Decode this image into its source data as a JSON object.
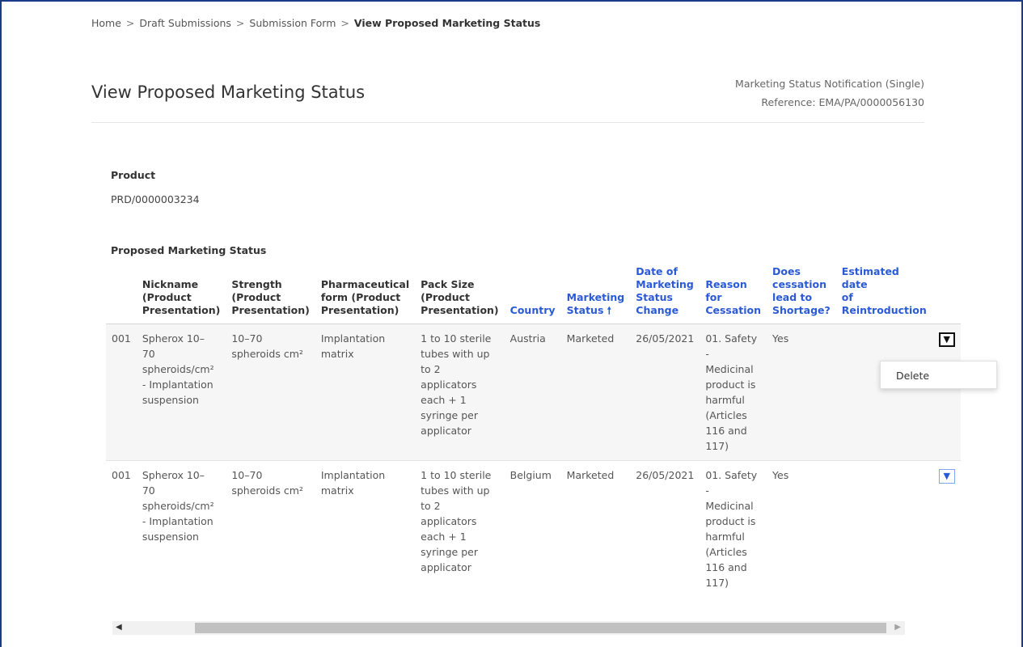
{
  "breadcrumb": {
    "items": [
      "Home",
      "Draft Submissions",
      "Submission Form"
    ],
    "current": "View Proposed Marketing Status",
    "separator": ">"
  },
  "page": {
    "title": "View Proposed Marketing Status",
    "notification_type": "Marketing Status Notification (Single)",
    "reference": "Reference: EMA/PA/0000056130"
  },
  "product": {
    "label": "Product",
    "value": "PRD/0000003234"
  },
  "section_title": "Proposed Marketing Status",
  "table": {
    "headers": {
      "nickname": [
        "Nickname",
        "(Product",
        "Presentation)"
      ],
      "strength": [
        "Strength",
        "(Product",
        "Presentation)"
      ],
      "form": [
        "Pharmaceutical",
        "form (Product",
        "Presentation)"
      ],
      "pack": [
        "Pack Size",
        "(Product",
        "Presentation)"
      ],
      "country": [
        "Country"
      ],
      "status": [
        "Marketing",
        "Status"
      ],
      "date": [
        "Date of",
        "Marketing",
        "Status",
        "Change"
      ],
      "reason": [
        "Reason",
        "for",
        "Cessation"
      ],
      "shortage": [
        "Does",
        "cessation",
        "lead to",
        "Shortage?"
      ],
      "reintro": [
        "Estimated date",
        "of",
        "Reintroduction"
      ]
    },
    "sort_arrow": "🠕",
    "rows": [
      {
        "id": "001",
        "nickname": [
          "Spherox 10–",
          "70",
          "spheroids/cm²",
          "- Implantation",
          "suspension"
        ],
        "strength": [
          "10–70",
          "spheroids cm²"
        ],
        "form": [
          "Implantation",
          "matrix"
        ],
        "pack": [
          "1 to 10 sterile",
          "tubes with up",
          "to 2",
          "applicators",
          "each + 1",
          "syringe per",
          "applicator"
        ],
        "country": "Austria",
        "status": "Marketed",
        "date": "26/05/2021",
        "reason": [
          "01. Safety",
          "-",
          "Medicinal",
          "product is",
          "harmful",
          "(Articles",
          "116 and",
          "117)"
        ],
        "shortage": "Yes",
        "reintro": ""
      },
      {
        "id": "001",
        "nickname": [
          "Spherox 10–",
          "70",
          "spheroids/cm²",
          "- Implantation",
          "suspension"
        ],
        "strength": [
          "10–70",
          "spheroids cm²"
        ],
        "form": [
          "Implantation",
          "matrix"
        ],
        "pack": [
          "1 to 10 sterile",
          "tubes with up",
          "to 2",
          "applicators",
          "each + 1",
          "syringe per",
          "applicator"
        ],
        "country": "Belgium",
        "status": "Marketed",
        "date": "26/05/2021",
        "reason": [
          "01. Safety",
          "-",
          "Medicinal",
          "product is",
          "harmful",
          "(Articles",
          "116 and",
          "117)"
        ],
        "shortage": "Yes",
        "reintro": ""
      }
    ]
  },
  "dropdown_menu": {
    "items": [
      "Delete"
    ]
  },
  "icons": {
    "row_action": "chevron-down-icon",
    "scroll_left": "triangle-left-icon",
    "scroll_right": "triangle-right-icon",
    "sort": "arrow-up-icon"
  },
  "colors": {
    "link_blue": "#2b5ad6",
    "frame_border": "#1a3a8a"
  }
}
